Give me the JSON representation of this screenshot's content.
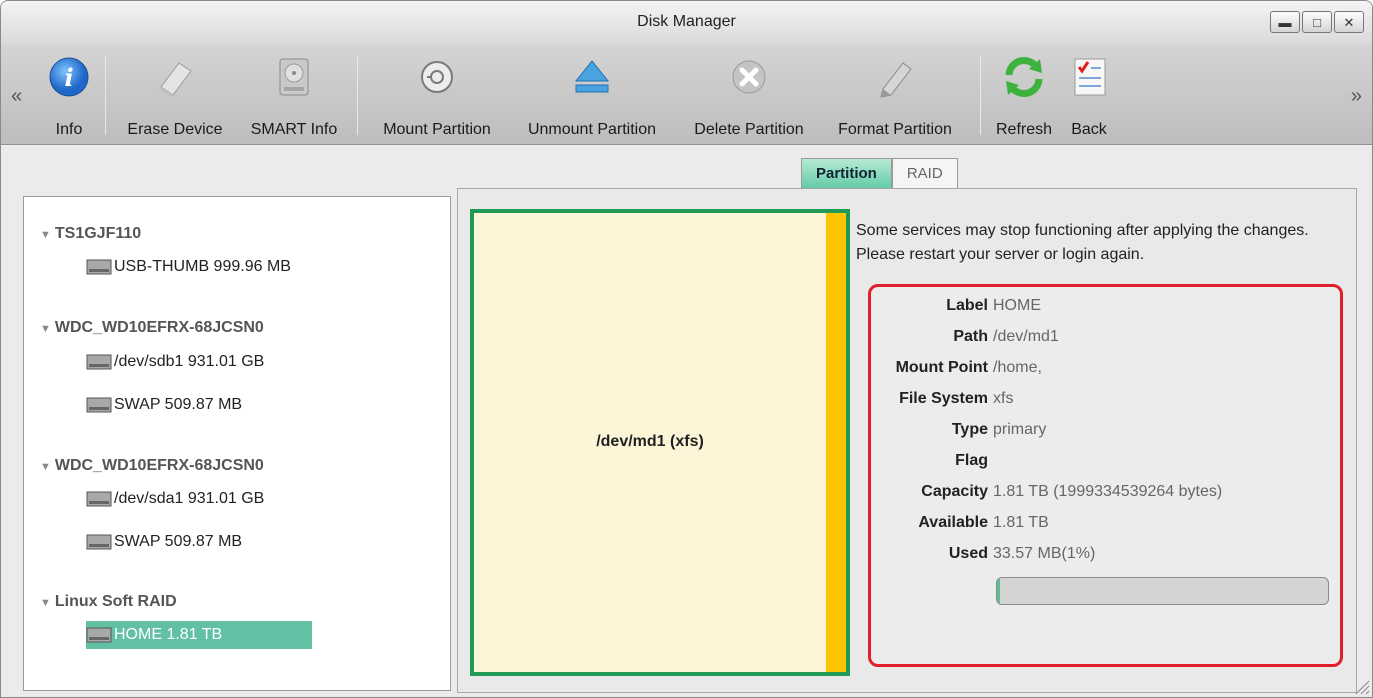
{
  "window": {
    "title": "Disk Manager"
  },
  "toolbar": {
    "items": [
      {
        "label": "Info",
        "icon": "info-icon"
      },
      {
        "label": "Erase Device",
        "icon": "eraser-icon"
      },
      {
        "label": "SMART Info",
        "icon": "hard-disk-icon"
      },
      {
        "label": "Mount Partition",
        "icon": "mount-icon"
      },
      {
        "label": "Unmount Partition",
        "icon": "eject-icon"
      },
      {
        "label": "Delete Partition",
        "icon": "delete-icon"
      },
      {
        "label": "Format Partition",
        "icon": "pencil-icon"
      },
      {
        "label": "Refresh",
        "icon": "refresh-icon"
      },
      {
        "label": "Back",
        "icon": "checklist-icon"
      }
    ]
  },
  "tree": {
    "groups": [
      {
        "name": "TS1GJF110",
        "items": [
          {
            "label": "USB-THUMB 999.96 MB"
          }
        ]
      },
      {
        "name": "WDC_WD10EFRX-68JCSN0",
        "items": [
          {
            "label": "/dev/sdb1 931.01 GB"
          },
          {
            "label": "SWAP 509.87 MB"
          }
        ]
      },
      {
        "name": "WDC_WD10EFRX-68JCSN0",
        "items": [
          {
            "label": "/dev/sda1 931.01 GB"
          },
          {
            "label": "SWAP 509.87 MB"
          }
        ]
      },
      {
        "name": "Linux Soft RAID",
        "items": [
          {
            "label": "HOME 1.81 TB",
            "selected": true
          }
        ]
      }
    ]
  },
  "tabs": [
    {
      "label": "Partition",
      "active": true
    },
    {
      "label": "RAID",
      "active": false
    }
  ],
  "partition": {
    "label": "/dev/md1 (xfs)"
  },
  "notice": "Some services may stop functioning after applying the changes. Please restart your server or login again.",
  "details": [
    {
      "key": "Label",
      "value": "HOME"
    },
    {
      "key": "Path",
      "value": "/dev/md1"
    },
    {
      "key": "Mount Point",
      "value": "/home,"
    },
    {
      "key": "File System",
      "value": "xfs"
    },
    {
      "key": "Type",
      "value": "primary"
    },
    {
      "key": "Flag",
      "value": ""
    },
    {
      "key": "Capacity",
      "value": "1.81 TB (1999334539264 bytes)"
    },
    {
      "key": "Available",
      "value": "1.81 TB"
    },
    {
      "key": "Used",
      "value": "33.57 MB(1%)"
    }
  ],
  "usage": {
    "fraction": 0.01
  },
  "colors": {
    "accent": "#62c0a4",
    "partition_border": "#1f9a55",
    "highlight_box": "#e01f2a",
    "swap_strip": "#fdc500"
  }
}
